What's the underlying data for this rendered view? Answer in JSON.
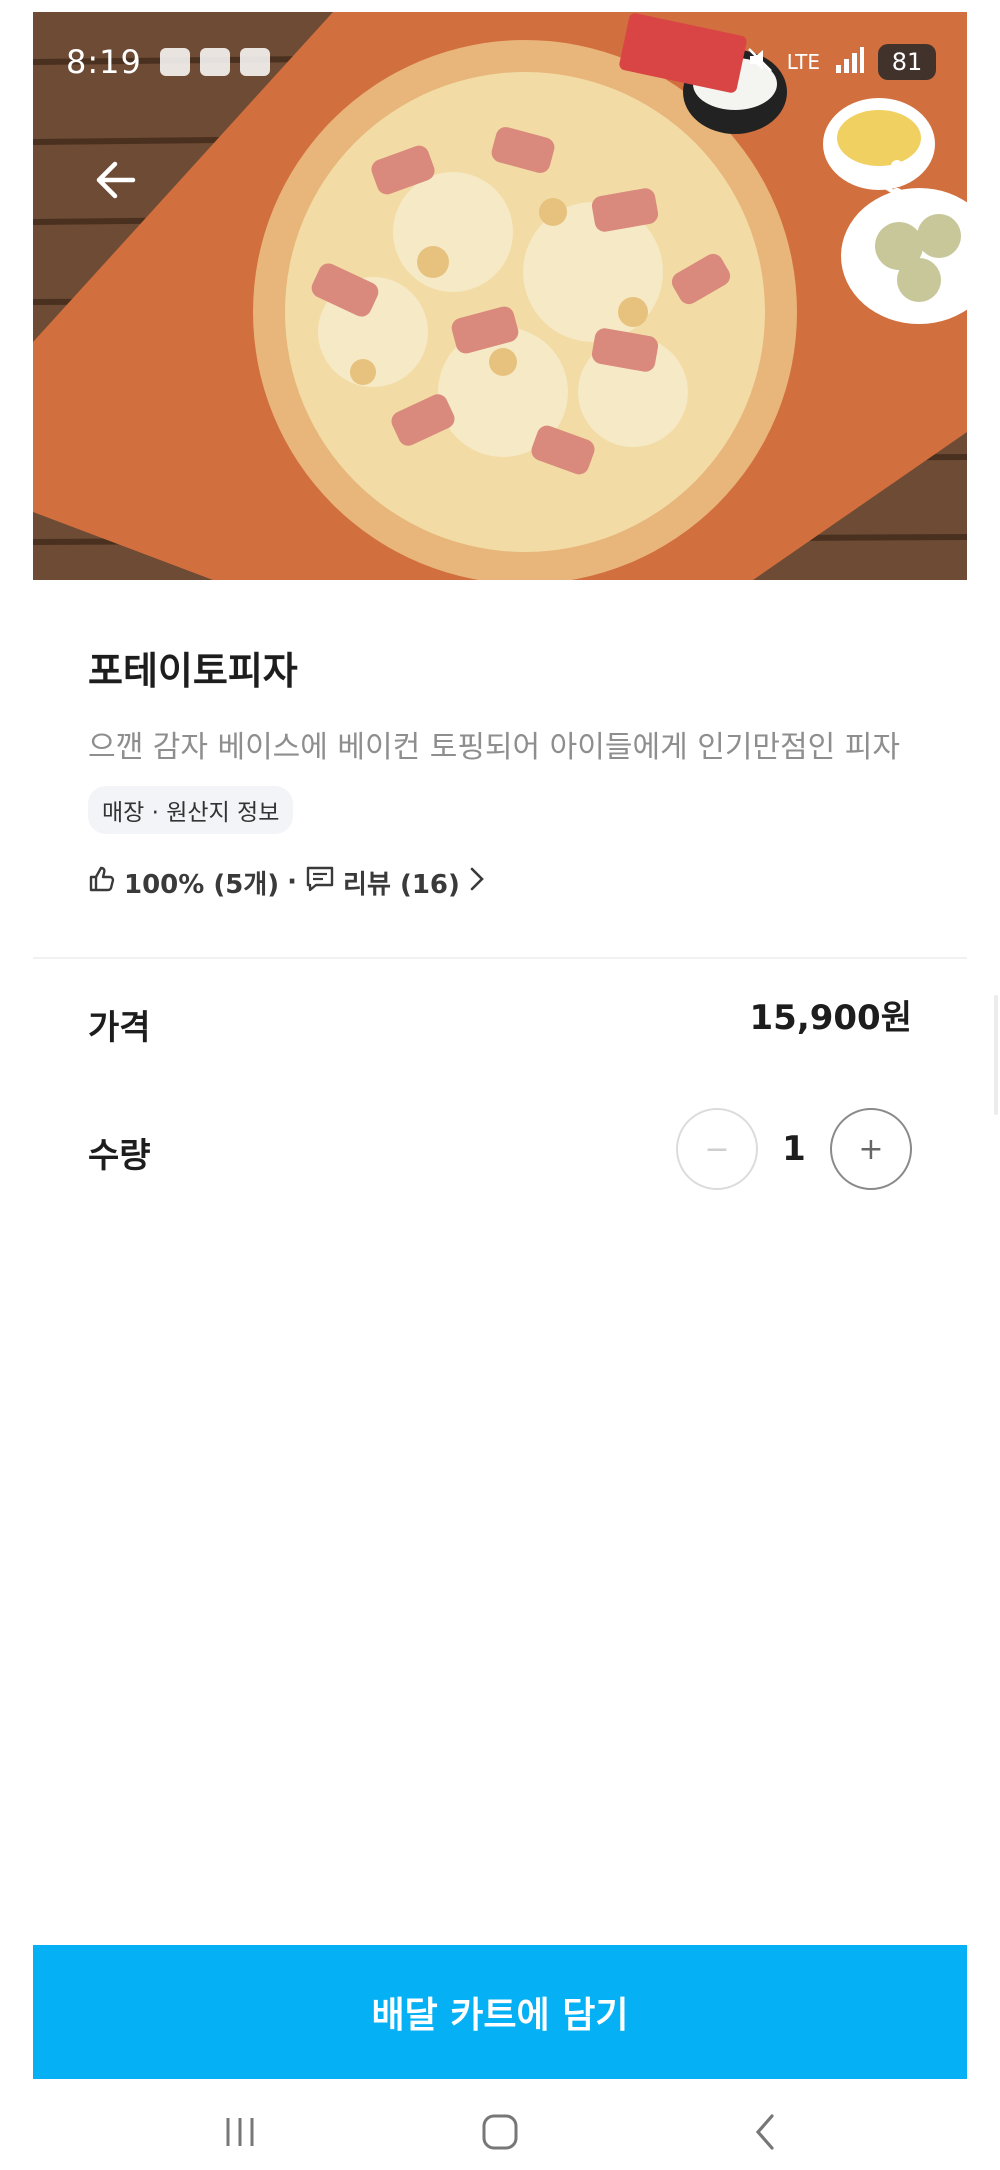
{
  "status_bar": {
    "time": "8:19",
    "network": "LTE",
    "battery": "81"
  },
  "product": {
    "name": "포테이토피자",
    "description": "으깬 감자 베이스에 베이컨 토핑되어 아이들에게 인기만점인 피자",
    "info_chip": "매장 · 원산지 정보",
    "rating": "100% (5개)",
    "separator": "·",
    "reviews": "리뷰 (16)"
  },
  "price": {
    "label": "가격",
    "value": "15,900원"
  },
  "quantity": {
    "label": "수량",
    "value": "1",
    "minus_symbol": "−",
    "plus_symbol": "+"
  },
  "cart_button": {
    "label": "배달 카트에 담기"
  },
  "colors": {
    "accent": "#06b0f5"
  },
  "icons": {
    "back": "arrow-left-icon",
    "share": "share-icon",
    "like": "thumbs-up-icon",
    "review": "comment-icon",
    "chevron": "chevron-right-icon"
  }
}
